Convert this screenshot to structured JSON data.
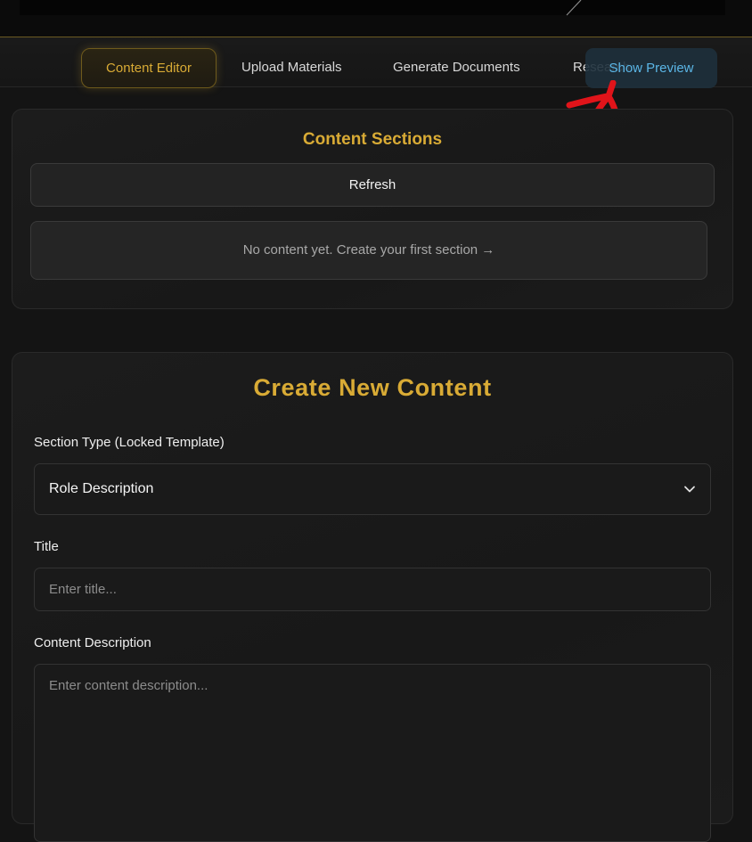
{
  "tabs": [
    {
      "label": "Content Editor",
      "active": true
    },
    {
      "label": "Upload Materials",
      "active": false
    },
    {
      "label": "Generate Documents",
      "active": false
    },
    {
      "label": "Research",
      "active": false
    }
  ],
  "preview_button": "Show Preview",
  "sections_card": {
    "title": "Content Sections",
    "refresh_label": "Refresh",
    "empty_text": "No content yet. Create your first section →"
  },
  "create_card": {
    "title": "Create New Content",
    "section_type_label": "Section Type (Locked Template)",
    "section_type_value": "Role Description",
    "title_label": "Title",
    "title_placeholder": "Enter title...",
    "description_label": "Content Description",
    "description_placeholder": "Enter content description..."
  },
  "colors": {
    "accent_gold": "#d9ab35",
    "preview_blue": "#5bb6e6",
    "annotation_red": "#e0141a"
  },
  "icons": [
    "chevron-down-icon",
    "annotation-arrow-icon"
  ]
}
